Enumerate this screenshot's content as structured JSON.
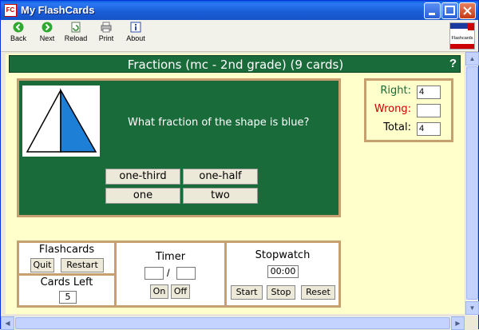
{
  "window": {
    "title": "My FlashCards",
    "app_icon_text": "FC"
  },
  "toolbar": {
    "back": "Back",
    "next": "Next",
    "reload": "Reload",
    "print": "Print",
    "about": "About"
  },
  "logo": {
    "text": "Flashcards"
  },
  "header": {
    "title": "Fractions (mc - 2nd grade) (9 cards)",
    "help": "?"
  },
  "card": {
    "question": "What fraction of the shape is blue?",
    "answers": [
      "one-third",
      "one-half",
      "one",
      "two"
    ],
    "shape_fill": "#1e7fd6"
  },
  "score": {
    "right_label": "Right:",
    "right_value": "4",
    "wrong_label": "Wrong:",
    "wrong_value": "",
    "total_label": "Total:",
    "total_value": "4"
  },
  "flashcards_panel": {
    "title": "Flashcards",
    "quit": "Quit",
    "restart": "Restart"
  },
  "cards_left_panel": {
    "title": "Cards Left",
    "value": "5"
  },
  "timer_panel": {
    "title": "Timer",
    "separator": "/",
    "min_value": "",
    "sec_value": "",
    "on": "On",
    "off": "Off"
  },
  "stopwatch_panel": {
    "title": "Stopwatch",
    "display": "00:00",
    "start": "Start",
    "stop": "Stop",
    "reset": "Reset"
  },
  "colors": {
    "board_green": "#1a6b3a",
    "frame_tan": "#c8a070",
    "page_bg": "#ffffcc",
    "right_color": "#1a6b3a",
    "wrong_color": "#cc0000"
  }
}
